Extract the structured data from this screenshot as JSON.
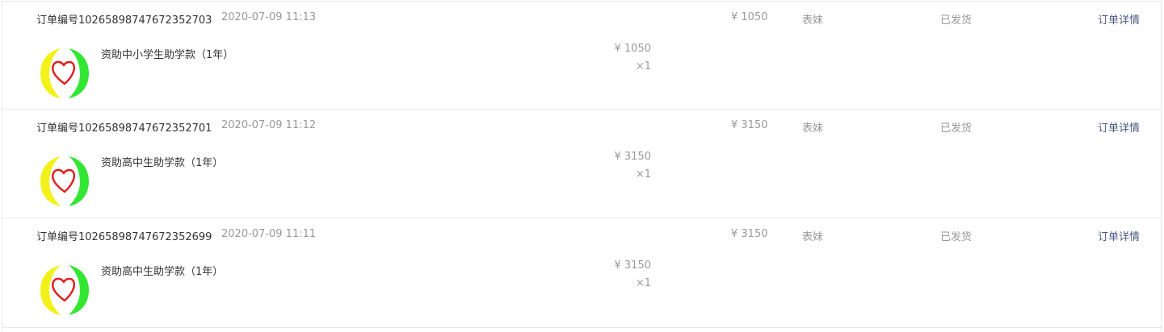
{
  "orders": [
    {
      "order_no": "订单编号10265898747672352703",
      "time": "2020-07-09 11:13",
      "total": "¥ 1050",
      "buyer": "表妹",
      "status": "已发货",
      "detail_link": "订单详情",
      "item": {
        "name": "资助中小学生助学款（1年）",
        "price": "¥ 1050",
        "qty": "×1",
        "icon": "heart-hands-logo"
      }
    },
    {
      "order_no": "订单编号10265898747672352701",
      "time": "2020-07-09 11:12",
      "total": "¥ 3150",
      "buyer": "表妹",
      "status": "已发货",
      "detail_link": "订单详情",
      "item": {
        "name": "资助高中生助学款（1年）",
        "price": "¥ 3150",
        "qty": "×1",
        "icon": "heart-hands-logo"
      }
    },
    {
      "order_no": "订单编号10265898747672352699",
      "time": "2020-07-09 11:11",
      "total": "¥ 3150",
      "buyer": "表妹",
      "status": "已发货",
      "detail_link": "订单详情",
      "item": {
        "name": "资助高中生助学款（1年）",
        "price": "¥ 3150",
        "qty": "×1",
        "icon": "heart-hands-logo"
      }
    }
  ],
  "colors": {
    "link": "#4a5a80",
    "muted": "#999999",
    "border": "#e8e8e8",
    "logo_yellow": "#f2f21a",
    "logo_green": "#33e633",
    "logo_heart": "#e02020"
  }
}
